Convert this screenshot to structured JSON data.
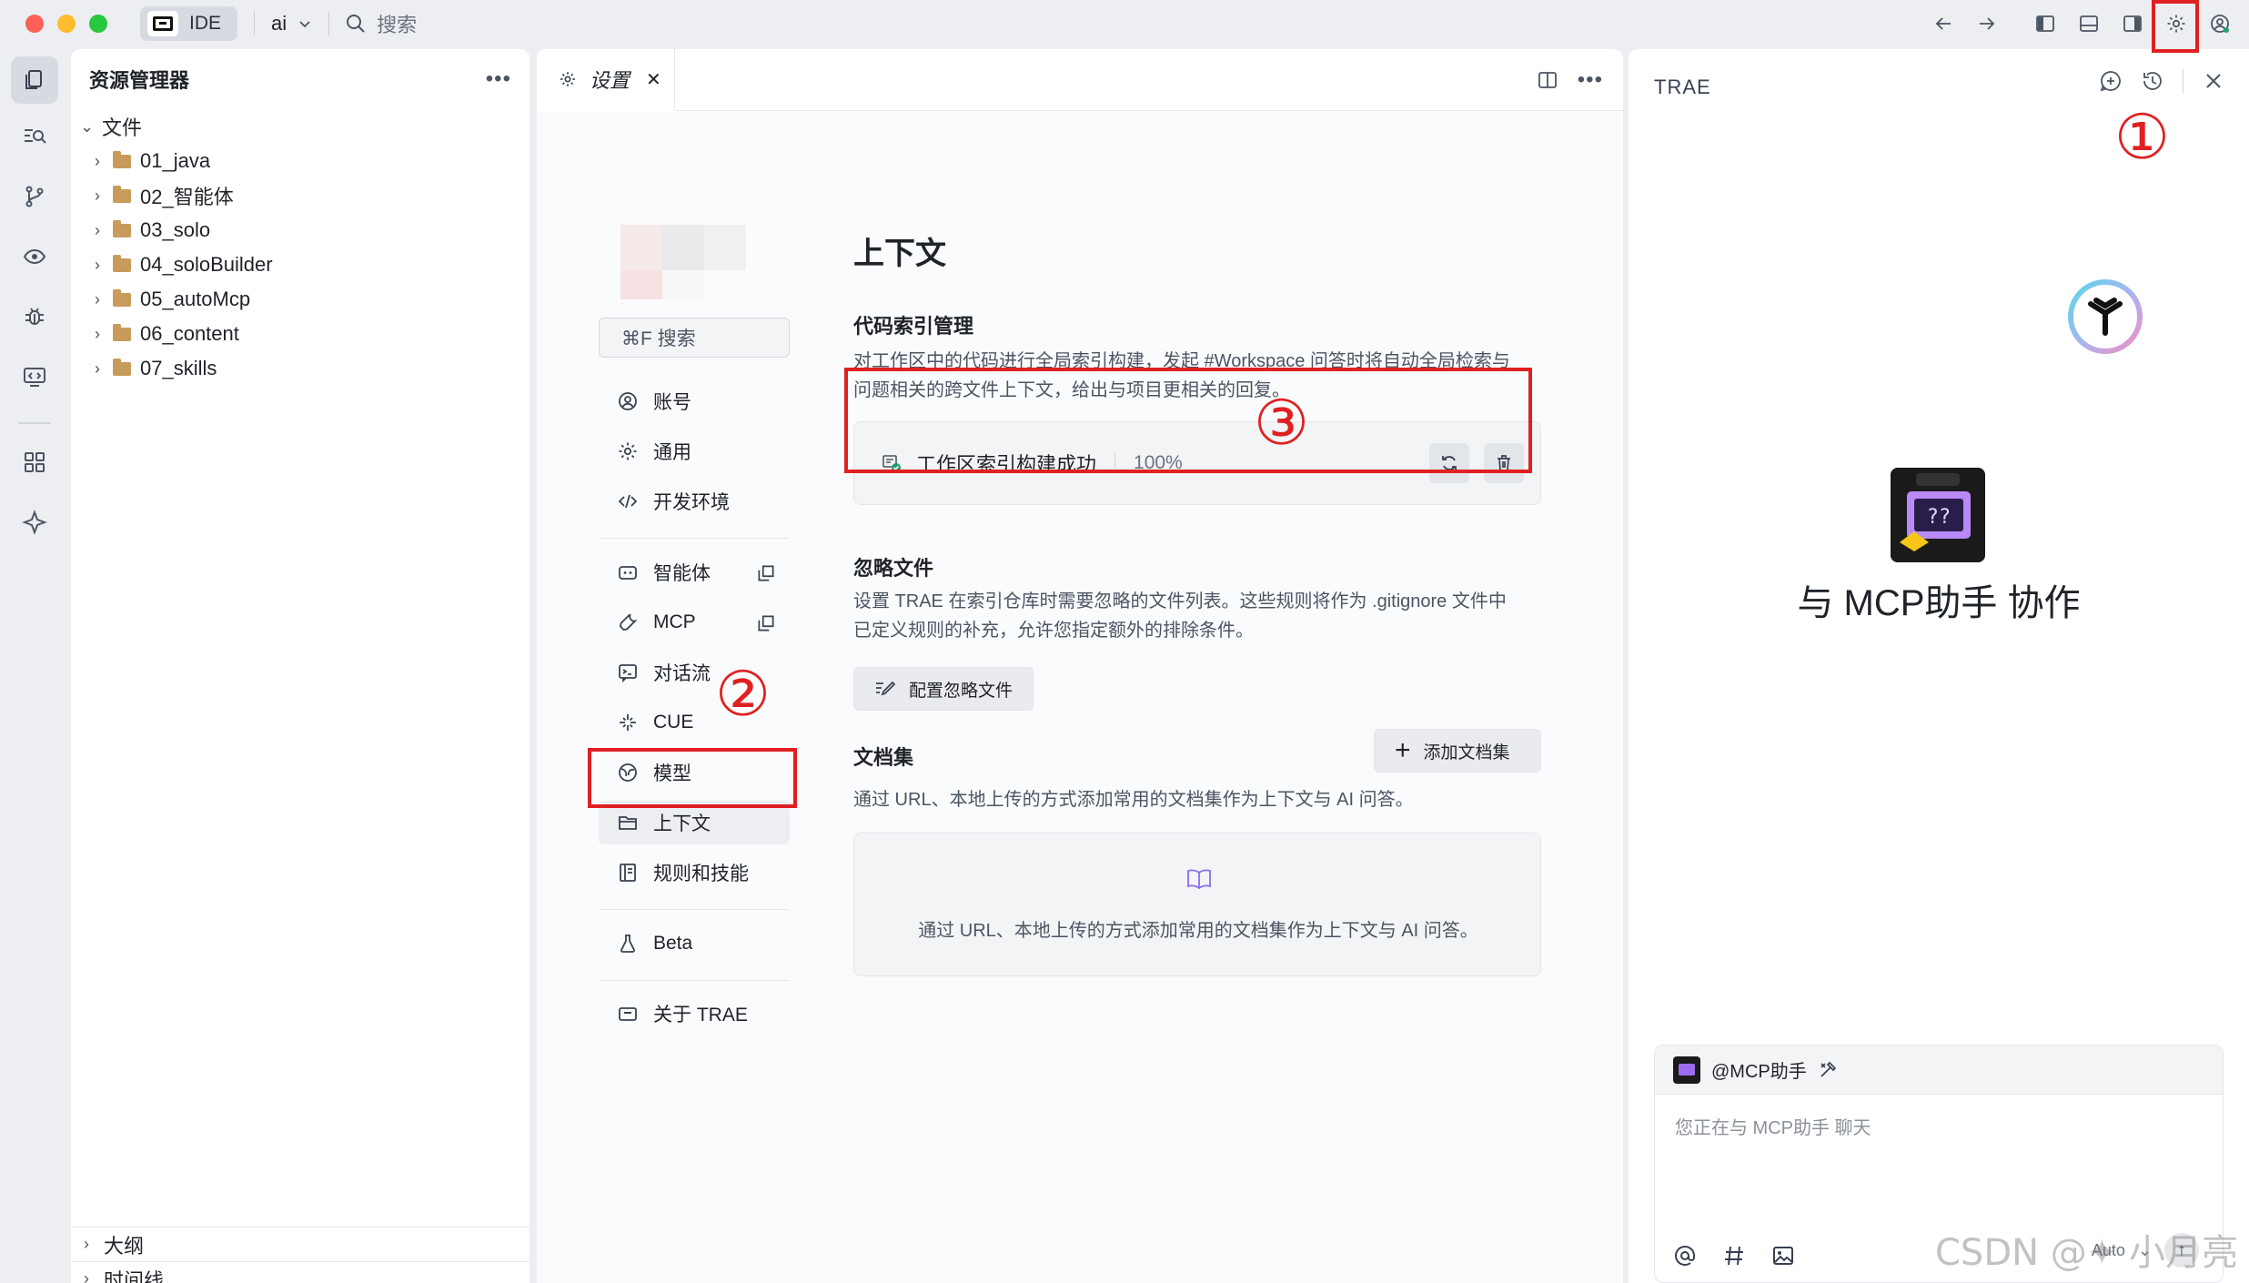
{
  "titlebar": {
    "mode_label": "IDE",
    "project_name": "ai",
    "search_placeholder": "搜索"
  },
  "explorer": {
    "title": "资源管理器",
    "root_label": "文件",
    "folders": [
      "01_java",
      "02_智能体",
      "03_solo",
      "04_soloBuilder",
      "05_autoMcp",
      "06_content",
      "07_skills"
    ],
    "outline_label": "大纲",
    "timeline_label": "时间线"
  },
  "settings": {
    "tab_label": "设置",
    "search_label": "⌘F 搜索",
    "nav": {
      "account": "账号",
      "general": "通用",
      "dev_env": "开发环境",
      "agents": "智能体",
      "mcp": "MCP",
      "dialog_flow": "对话流",
      "cue": "CUE",
      "model": "模型",
      "context": "上下文",
      "rules_skills": "规则和技能",
      "beta": "Beta",
      "about": "关于 TRAE"
    },
    "page_title": "上下文",
    "code_index": {
      "heading": "代码索引管理",
      "desc_line1": "对工作区中的代码进行全局索引构建，发起 #Workspace 问答时将自动全局检索与",
      "desc_line2": "问题相关的跨文件上下文，给出与项目更相关的回复。",
      "status_label": "工作区索引构建成功",
      "progress_text": "100%",
      "progress_value": 100
    },
    "ignore": {
      "heading": "忽略文件",
      "desc_line1": "设置 TRAE 在索引仓库时需要忽略的文件列表。这些规则将作为 .gitignore 文件中",
      "desc_line2": "已定义规则的补充，允许您指定额外的排除条件。",
      "button_label": "配置忽略文件"
    },
    "docs": {
      "heading": "文档集",
      "add_button_label": "添加文档集",
      "desc": "通过 URL、本地上传的方式添加常用的文档集作为上下文与 AI 问答。",
      "empty_text": "通过 URL、本地上传的方式添加常用的文档集作为上下文与 AI 问答。"
    }
  },
  "chat": {
    "title": "TRAE",
    "collab_prefix": "与 ",
    "collab_agent": "MCP助手",
    "collab_suffix": " 协作",
    "agent_mention": "@MCP助手",
    "input_placeholder": "您正在与 MCP助手 聊天",
    "model_label": "Auto"
  },
  "annotations": {
    "marker_1": "①",
    "marker_2": "②",
    "marker_3": "③",
    "watermark": "CSDN @✦ 小月亮"
  },
  "colors": {
    "annotation_red": "#e02020",
    "success_green": "#22a06b",
    "folder_brown": "#c89b5c",
    "agent_purple": "#9d6bf0"
  }
}
